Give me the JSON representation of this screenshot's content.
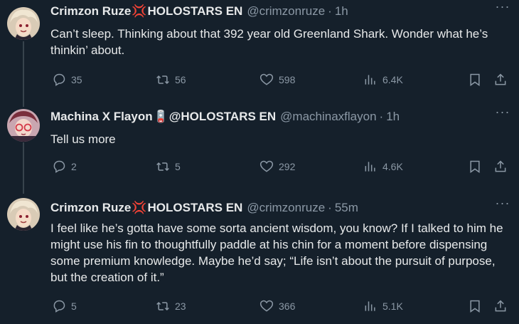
{
  "tweets": [
    {
      "name": "Crimzon Ruze",
      "badge": "💢",
      "name_suffix": "HOLOSTARS EN",
      "handle": "@crimzonruze",
      "time": "1h",
      "text": "Can’t sleep.  Thinking about that 392 year old Greenland Shark.  Wonder what he’s thinkin’ about.",
      "replies": "35",
      "retweets": "56",
      "likes": "598",
      "views": "6.4K"
    },
    {
      "name": "Machina X Flayon",
      "badge": "🪫",
      "name_suffix": "@HOLOSTARS EN",
      "handle": "@machinaxflayon",
      "time": "1h",
      "text": "Tell us more",
      "replies": "2",
      "retweets": "5",
      "likes": "292",
      "views": "4.6K"
    },
    {
      "name": "Crimzon Ruze",
      "badge": "💢",
      "name_suffix": "HOLOSTARS EN",
      "handle": "@crimzonruze",
      "time": "55m",
      "text": "I feel like he’s gotta have some sorta ancient wisdom, you know?  If I talked to him he might use his fin to thoughtfully paddle at his chin for a moment before dispensing some premium knowledge.  Maybe he’d say; “Life isn’t about the pursuit of purpose, but the creation of it.”",
      "replies": "5",
      "retweets": "23",
      "likes": "366",
      "views": "5.1K"
    }
  ],
  "more_label": "···",
  "icons": [
    "reply-icon",
    "retweet-icon",
    "like-icon",
    "views-icon",
    "bookmark-icon",
    "share-icon"
  ],
  "colors": {
    "background": "#15202b",
    "text": "#e7e9ea",
    "muted": "#8b98a5",
    "thread_line": "#38444d"
  }
}
